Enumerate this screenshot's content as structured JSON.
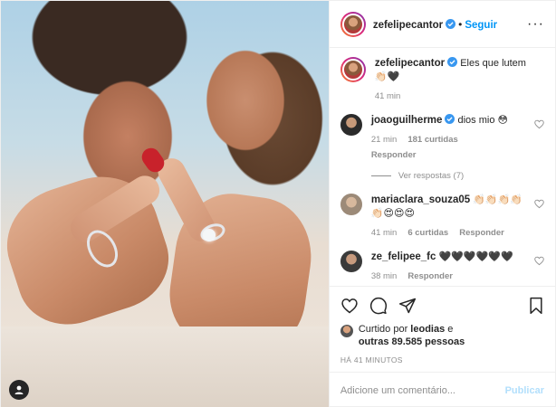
{
  "header": {
    "username": "zefelipecantor",
    "dot": "•",
    "follow_label": "Seguir",
    "more_label": "···"
  },
  "caption": {
    "username": "zefelipecantor",
    "text": "Eles que lutem 👏🏻🖤",
    "time": "41 min"
  },
  "comments": [
    {
      "username": "joaoguilherme",
      "text": "dios mio 😳",
      "time": "21 min",
      "likes": "181 curtidas",
      "reply_label": "Responder",
      "view_replies": "Ver respostas (7)"
    },
    {
      "username": "mariaclara_souza05",
      "text": "👏🏻👏🏻👏🏻👏🏻👏🏻😍😍😍",
      "time": "41 min",
      "likes": "6 curtidas",
      "reply_label": "Responder"
    },
    {
      "username": "ze_felipee_fc",
      "text": "🖤🖤🖤🖤🖤🖤",
      "time": "38 min",
      "reply_label": "Responder"
    }
  ],
  "liked_by": {
    "prefix": "Curtido por",
    "user": "leodias",
    "connector": "e",
    "others": "outras 89.585 pessoas"
  },
  "timestamp": "HÁ 41 MINUTOS",
  "add_comment": {
    "placeholder": "Adicione um comentário...",
    "post_label": "Publicar"
  },
  "colors": {
    "link_blue": "#0095f6",
    "post_disabled": "#b2dffc",
    "muted": "#8e8e8e",
    "text": "#262626"
  }
}
